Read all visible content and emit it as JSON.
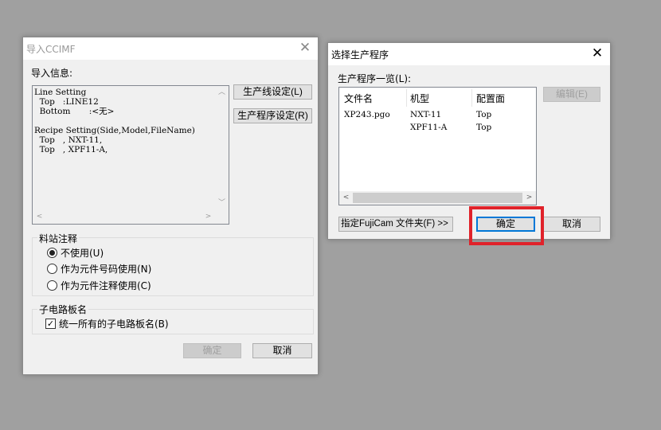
{
  "left_dialog": {
    "title": "导入CCIMF",
    "info_label": "导入信息:",
    "info_lines": [
      "Line Setting",
      "  Top   :LINE12",
      "  Bottom       :<无>",
      "",
      "Recipe Setting(Side,Model,FileName)",
      "  Top   , NXT-11,",
      "  Top   , XPF11-A,"
    ],
    "line_setting_button": "生产线设定(L)",
    "recipe_setting_button": "生产程序设定(R)",
    "feeder_group": {
      "label": "料站注释",
      "options": [
        {
          "label": "不使用(U)",
          "selected": true
        },
        {
          "label": "作为元件号码使用(N)",
          "selected": false
        },
        {
          "label": "作为元件注释使用(C)",
          "selected": false
        }
      ]
    },
    "subboard_group": {
      "label": "子电路板名",
      "checkbox_label": "统一所有的子电路板名(B)",
      "checked": true
    },
    "ok_button": "确定",
    "cancel_button": "取消"
  },
  "right_dialog": {
    "title": "选择生产程序",
    "list_label": "生产程序一览(L):",
    "columns": [
      "文件名",
      "机型",
      "配置面"
    ],
    "rows": [
      {
        "file": "XP243.pgo",
        "model": "NXT-11",
        "side": "Top"
      },
      {
        "file": "",
        "model": "XPF11-A",
        "side": "Top"
      }
    ],
    "edit_button": "编辑(E)",
    "folder_button": "指定FujiCam 文件夹(F) >>",
    "ok_button": "确定",
    "cancel_button": "取消"
  },
  "colors": {
    "highlight": "#e0222a",
    "desktop": "#a0a0a0"
  }
}
